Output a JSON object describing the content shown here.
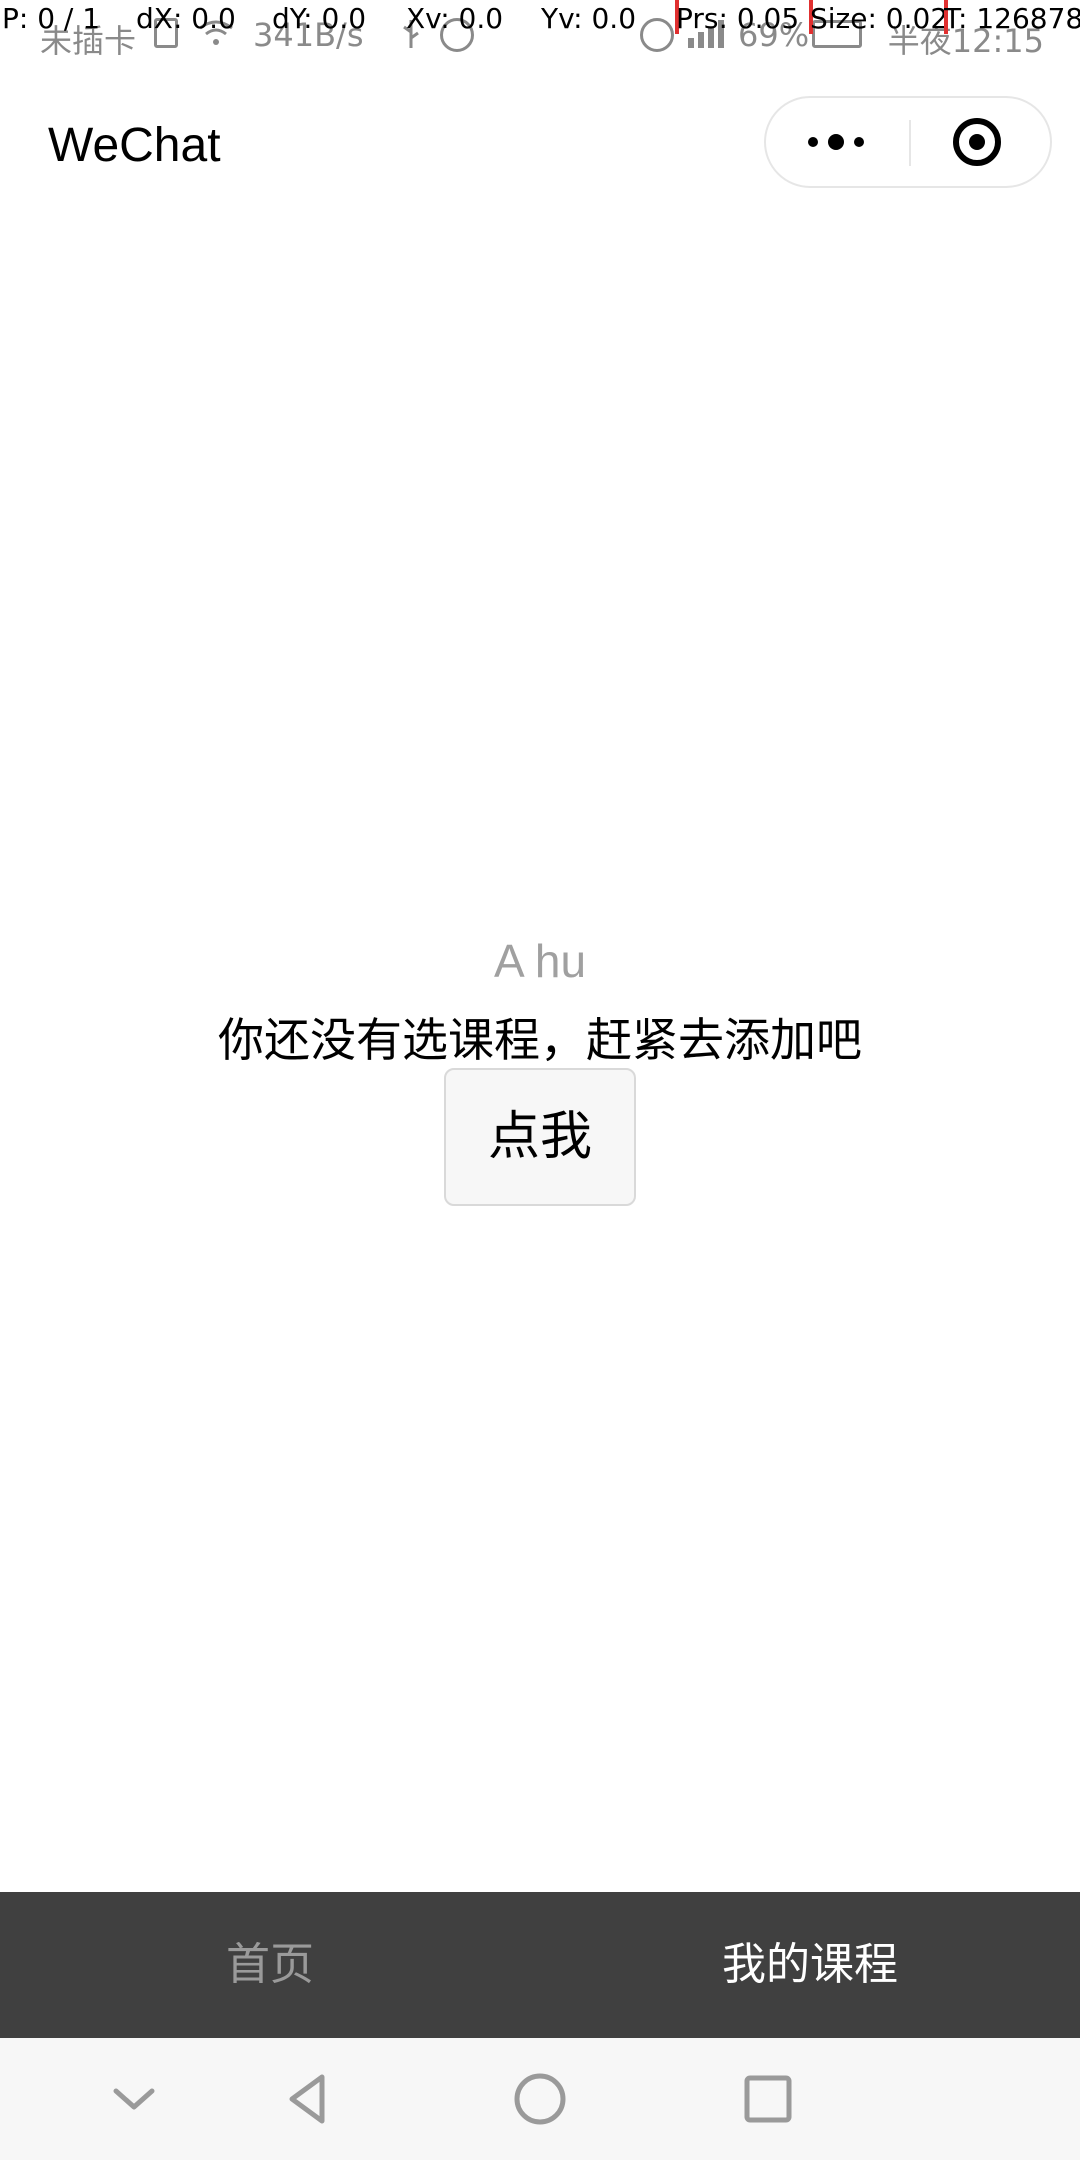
{
  "status_bar": {
    "carrier": "未插卡",
    "speed": "341B/s",
    "battery": "69%",
    "time": "半夜12:15",
    "icons": [
      "sim-icon",
      "wifi-icon",
      "usb-icon",
      "alarm-icon",
      "clock-icon",
      "signal-icon",
      "battery-icon"
    ]
  },
  "debug_overlay": {
    "p": "P: 0 / 1",
    "dx": "dX: 0.0",
    "dy": "dY: 0.0",
    "xv": "Xv: 0.0",
    "yv": "Yv: 0.0",
    "prs": "Prs: 0.05",
    "size": "Size: 0.02",
    "t": "T: 126878"
  },
  "title_bar": {
    "title": "WeChat",
    "capsule_icons": [
      "more-icon",
      "close-miniprogram-icon"
    ]
  },
  "main": {
    "name": "A hu",
    "empty_message": "你还没有选课程，赶紧去添加吧",
    "button_label": "点我"
  },
  "tab_bar": {
    "tabs": [
      {
        "label": "首页",
        "active": false
      },
      {
        "label": "我的课程",
        "active": true
      }
    ],
    "background": "#404040",
    "active_color": "#ffffff",
    "inactive_color": "#9a9a9a"
  },
  "nav_bar": {
    "buttons": [
      "hide-keyboard-icon",
      "back-icon",
      "home-icon",
      "recents-icon"
    ]
  }
}
